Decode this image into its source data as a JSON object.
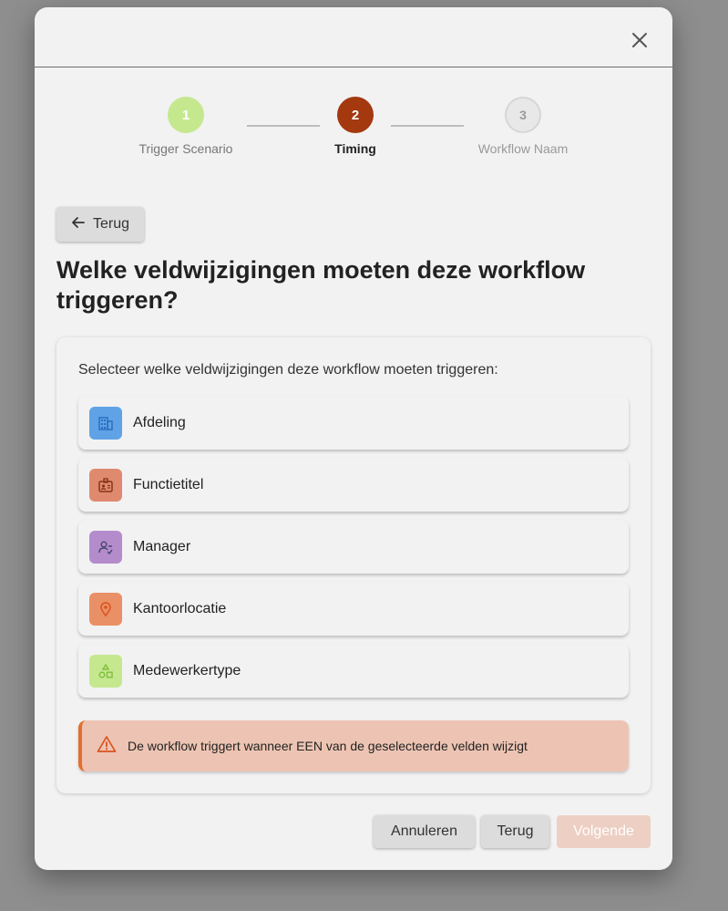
{
  "dialog": {
    "close_icon": "close-icon"
  },
  "stepper": {
    "steps": [
      {
        "number": "1",
        "label": "Trigger Scenario",
        "state": "completed",
        "color": "#c5e88f"
      },
      {
        "number": "2",
        "label": "Timing",
        "state": "active",
        "color": "#a4380f"
      },
      {
        "number": "3",
        "label": "Workflow Naam",
        "state": "pending",
        "color": "#e8e8e8"
      }
    ]
  },
  "back_link": {
    "icon": "arrow-left-icon",
    "label": "Terug"
  },
  "title": "Welke veldwijzigingen moeten deze workflow triggeren?",
  "card": {
    "intro": "Selecteer welke veldwijzigingen deze workflow moeten triggeren:",
    "fields": [
      {
        "label": "Afdeling",
        "icon": "building-icon",
        "color": "#5fa3e6"
      },
      {
        "label": "Functietitel",
        "icon": "badge-icon",
        "color": "#df8a6f"
      },
      {
        "label": "Manager",
        "icon": "manager-icon",
        "color": "#b48ccc"
      },
      {
        "label": "Kantoorlocatie",
        "icon": "location-pin-icon",
        "color": "#ea9066"
      },
      {
        "label": "Medewerkertype",
        "icon": "category-shapes-icon",
        "color": "#c5e88f"
      }
    ],
    "alert": {
      "icon": "warning-icon",
      "text": "De workflow triggert wanneer EEN van de geselecteerde velden wijzigt",
      "accent": "#e0702f"
    }
  },
  "footer": {
    "cancel_label": "Annuleren",
    "back_label": "Terug",
    "next_label": "Volgende"
  }
}
